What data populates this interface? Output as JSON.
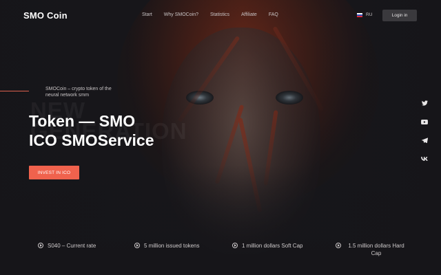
{
  "header": {
    "logo": "SMO Coin",
    "nav": [
      "Start",
      "Why SMOCoin?",
      "Statistics",
      "Affiliate",
      "FAQ"
    ],
    "language": "RU",
    "login_label": "Login in"
  },
  "hero": {
    "tagline": "SMOCoin – crypto token of the neural network smm",
    "ghost_text": [
      "NEW",
      "GENERATION"
    ],
    "title_line1": "Token — SMO",
    "title_line2": "ICO SMOService",
    "cta_label": "INVEST IN ICO"
  },
  "social": [
    "twitter-icon",
    "youtube-icon",
    "telegram-icon",
    "vk-icon"
  ],
  "stats": [
    "S040 – Current rate",
    "5 million issued tokens",
    "1 million dollars Soft Cap",
    "1.5 million dollars Hard Cap"
  ],
  "colors": {
    "accent": "#f0624d",
    "background": "#17161a",
    "login_bg": "#3a393d"
  }
}
